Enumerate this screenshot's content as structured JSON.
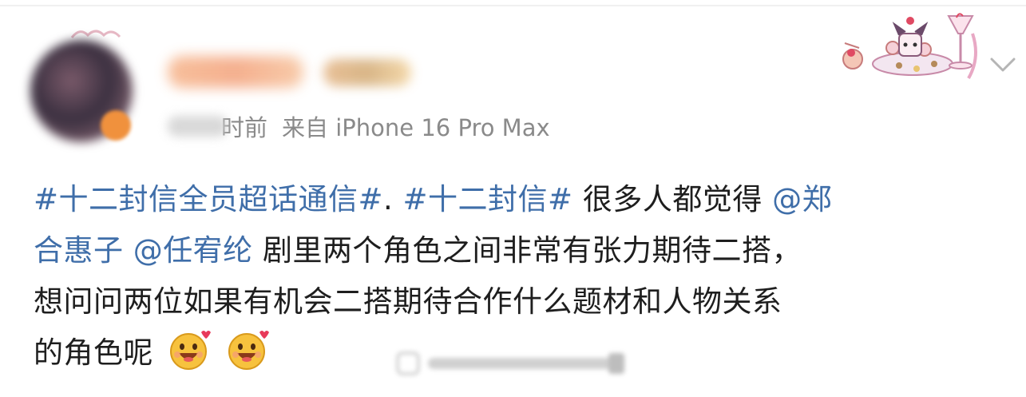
{
  "post": {
    "author_name": "",
    "time": "时前",
    "source": "来自 iPhone 16 Pro Max",
    "line1": {
      "topic1": "#十二封信全员超话通信#",
      "sep": ". ",
      "topic2": "#十二封信#",
      "text": " 很多人都觉得 ",
      "mention_start": "@郑"
    },
    "line2": {
      "mention_end": "合惠子",
      "space": " ",
      "mention2": "@任宥纶",
      "text": " 剧里两个角色之间非常有张力期待二搭，"
    },
    "line3": "想问问两位如果有机会二搭期待合作什么题材和人物关系",
    "line4": "的角色呢",
    "emojis": [
      "happy-face-emoji",
      "happy-face-emoji"
    ]
  },
  "colors": {
    "link": "#3f6ea9",
    "text": "#1e1e1e",
    "meta": "#8a8a8a"
  }
}
